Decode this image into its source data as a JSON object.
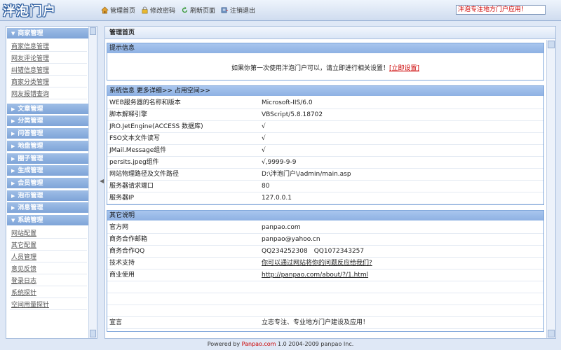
{
  "logo": "泮泡门户",
  "topnav": [
    {
      "label": "管理首页",
      "icon": "home-icon"
    },
    {
      "label": "修改密码",
      "icon": "lock-icon"
    },
    {
      "label": "刷新页面",
      "icon": "refresh-icon"
    },
    {
      "label": "注销退出",
      "icon": "logout-icon"
    }
  ],
  "search_value": "泮泡专注地方门户应用！",
  "sidebar": {
    "sections": [
      {
        "label": "商家管理",
        "expanded": true,
        "items": [
          "商家信息管理",
          "网友评论管理",
          "纠错信息管理",
          "商家分类管理",
          "网友报错查询"
        ]
      },
      {
        "label": "文章管理"
      },
      {
        "label": "分类管理"
      },
      {
        "label": "问答管理"
      },
      {
        "label": "地盘管理"
      },
      {
        "label": "圈子管理"
      },
      {
        "label": "生成管理"
      },
      {
        "label": "会员管理"
      },
      {
        "label": "泡币管理"
      },
      {
        "label": "消息管理"
      },
      {
        "label": "系统管理",
        "expanded": true,
        "items": [
          "网站配置",
          "其它配置",
          "人员管理",
          "意见反馈",
          "登录日志",
          "系统探针",
          "空间用量探针"
        ]
      }
    ]
  },
  "main": {
    "title": "管理首页",
    "tip": {
      "head": "提示信息",
      "text": "如果你第一次使用泮泡门户可以，请立即进行相关设置！",
      "link": "[立即设置]"
    },
    "sys": {
      "head_label": "系统信息",
      "head_more": "更多详细>>",
      "head_space": "占用空间>>",
      "rows": [
        {
          "k": "WEB服务器的名称和版本",
          "v": "Microsoft-IIS/6.0"
        },
        {
          "k": "脚本解释引擎",
          "v": "VBScript/5.8.18702"
        },
        {
          "k": "JRO.JetEngine(ACCESS 数据库)",
          "v": "√"
        },
        {
          "k": "FSO文本文件读写",
          "v": "√"
        },
        {
          "k": "JMail.Message组件",
          "v": "√"
        },
        {
          "k": "persits.jpeg组件",
          "v": "√,9999-9-9"
        },
        {
          "k": "网站物理路径及文件路径",
          "v": "D:\\泮泡门户\\/admin/main.asp"
        },
        {
          "k": "服务器请求端口",
          "v": "80"
        },
        {
          "k": "服务器IP",
          "v": "127.0.0.1"
        }
      ]
    },
    "other": {
      "head": "其它说明",
      "rows": [
        {
          "k": "官方网",
          "v": "panpao.com"
        },
        {
          "k": "商务合作邮箱",
          "v": "panpao@yahoo.cn"
        },
        {
          "k": "商务合作QQ",
          "v": "QQ234252308　QQ1072343257"
        },
        {
          "k": "技术支持",
          "v": "你可以通过网站将你的问题反应给我们?"
        },
        {
          "k": "商业使用",
          "v": "http://panpao.com/about/?/1.html"
        }
      ],
      "motto_k": "宣言",
      "motto_v": "立志专注、专业地方门户建设及应用！"
    }
  },
  "footer": {
    "prefix": "Powered by",
    "brand": "Panpao.com",
    "suffix": "1.0 2004-2009 panpao Inc."
  },
  "colors": {
    "accent": "#7ea4d8",
    "link_red": "#cc0000",
    "panel_border": "#a8bedd"
  }
}
